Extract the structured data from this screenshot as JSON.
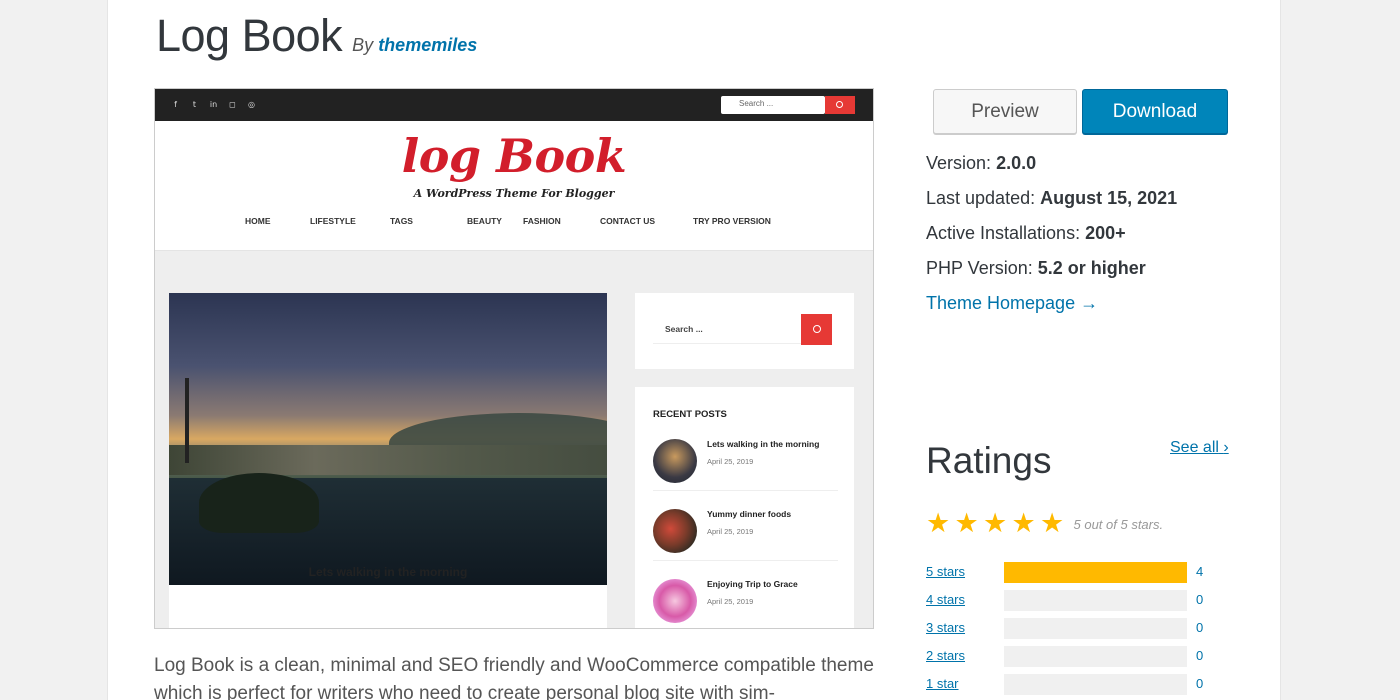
{
  "header": {
    "title": "Log Book",
    "by_label": "By",
    "author": "thememiles"
  },
  "screenshot": {
    "top_bar": {
      "social_icons": [
        "facebook-icon",
        "twitter-icon",
        "linkedin-icon",
        "instagram-icon",
        "pinterest-icon"
      ],
      "search_placeholder": "Search ..."
    },
    "logo": "log Book",
    "tagline": "A WordPress Theme For Blogger",
    "nav": [
      "HOME",
      "LIFESTYLE",
      "TAGS",
      "BEAUTY",
      "FASHION",
      "CONTACT US",
      "TRY PRO VERSION"
    ],
    "post_caption": "Lets walking in the morning",
    "sidebar_search_placeholder": "Search ...",
    "recent_posts_heading": "RECENT POSTS",
    "recent_posts": [
      {
        "title": "Lets walking in the morning",
        "date": "April 25, 2019"
      },
      {
        "title": "Yummy dinner foods",
        "date": "April 25, 2019"
      },
      {
        "title": "Enjoying Trip to Grace",
        "date": "April 25, 2019"
      }
    ]
  },
  "actions": {
    "preview_label": "Preview",
    "download_label": "Download"
  },
  "meta": {
    "version_label": "Version:",
    "version": "2.0.0",
    "updated_label": "Last updated:",
    "updated": "August 15, 2021",
    "installs_label": "Active Installations:",
    "installs": "200+",
    "php_label": "PHP Version:",
    "php": "5.2 or higher",
    "homepage_link": "Theme Homepage →"
  },
  "ratings": {
    "heading": "Ratings",
    "see_all": "See all",
    "summary": "5 out of 5 stars.",
    "stars_filled": 5,
    "rows": [
      {
        "label": "5 stars",
        "count": "4",
        "fraction": 1.0
      },
      {
        "label": "4 stars",
        "count": "0",
        "fraction": 0
      },
      {
        "label": "3 stars",
        "count": "0",
        "fraction": 0
      },
      {
        "label": "2 stars",
        "count": "0",
        "fraction": 0
      },
      {
        "label": "1 star",
        "count": "0",
        "fraction": 0
      }
    ]
  },
  "description": "Log Book is a clean, minimal and SEO friendly and WooCommerce compatible theme which is perfect for writers who need to create personal blog site with sim-",
  "colors": {
    "link": "#0073aa",
    "download_button": "#0085ba",
    "star": "#ffb900",
    "theme_accent": "#e63935"
  }
}
